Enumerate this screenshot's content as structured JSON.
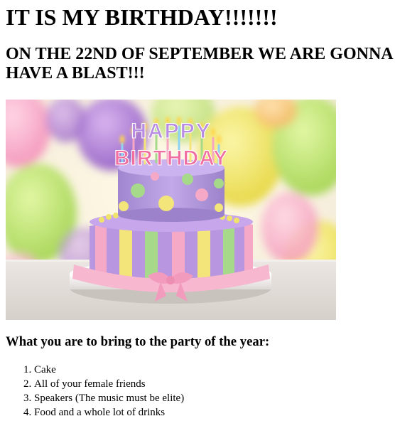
{
  "heading_main": "IT IS MY BIRTHDAY!!!!!!!",
  "heading_sub": "ON THE 22ND OF SEPTEMBER WE ARE GONNA HAVE A BLAST!!!",
  "image": {
    "cake_text_top": "HAPPY",
    "cake_text_bottom": "BIRTHDAY"
  },
  "bring_heading": "What you are to bring to the party of the year:",
  "bring_list": [
    "Cake",
    "All of your female friends",
    "Speakers (The music must be elite)",
    "Food and a whole lot of drinks"
  ]
}
